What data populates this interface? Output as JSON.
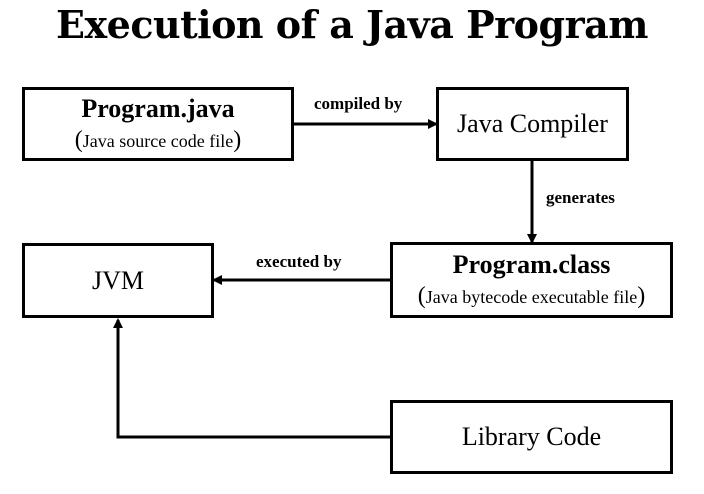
{
  "title": "Execution of a Java Program",
  "nodes": {
    "program_java": {
      "label": "Program.java",
      "sublabel": "Java source code file"
    },
    "java_compiler": {
      "label": "Java Compiler"
    },
    "program_class": {
      "label": "Program.class",
      "sublabel": "Java bytecode executable file"
    },
    "jvm": {
      "label": "JVM"
    },
    "library_code": {
      "label": "Library Code"
    }
  },
  "edges": {
    "compiled_by": "compiled by",
    "generates": "generates",
    "executed_by": "executed by"
  },
  "paren_open": "(",
  "paren_close": ")"
}
